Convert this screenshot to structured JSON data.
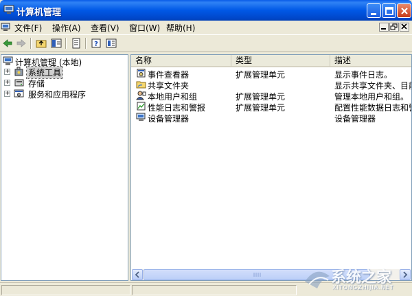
{
  "window": {
    "title": "计算机管理"
  },
  "menu": {
    "items": [
      "文件(F)",
      "操作(A)",
      "查看(V)",
      "窗口(W)",
      "帮助(H)"
    ]
  },
  "toolbar": {
    "buttons": [
      "back-icon",
      "forward-icon",
      "up-folder-icon",
      "show-hide-tree-icon",
      "export-list-icon",
      "help-icon",
      "properties-icon"
    ]
  },
  "tree": {
    "root": "计算机管理 (本地)",
    "items": [
      {
        "label": "系统工具",
        "expander": "+",
        "selected": true
      },
      {
        "label": "存储",
        "expander": "+"
      },
      {
        "label": "服务和应用程序",
        "expander": "+"
      }
    ]
  },
  "list": {
    "columns": [
      "名称",
      "类型",
      "描述"
    ],
    "rows": [
      {
        "name": "事件查看器",
        "type": "扩展管理单元",
        "desc": "显示事件日志。"
      },
      {
        "name": "共享文件夹",
        "type": "",
        "desc": "显示共享文件夹、目前"
      },
      {
        "name": "本地用户和组",
        "type": "扩展管理单元",
        "desc": "管理本地用户和组。"
      },
      {
        "name": "性能日志和警报",
        "type": "扩展管理单元",
        "desc": "配置性能数据日志和警"
      },
      {
        "name": "设备管理器",
        "type": "",
        "desc": "设备管理器"
      }
    ]
  },
  "watermark": {
    "text": "系统之家",
    "sub": "XITONGZHIJIA.NET"
  },
  "colors": {
    "title_bar": "#0058e6",
    "window_bg": "#ece9d8",
    "close_button": "#c63b18"
  }
}
